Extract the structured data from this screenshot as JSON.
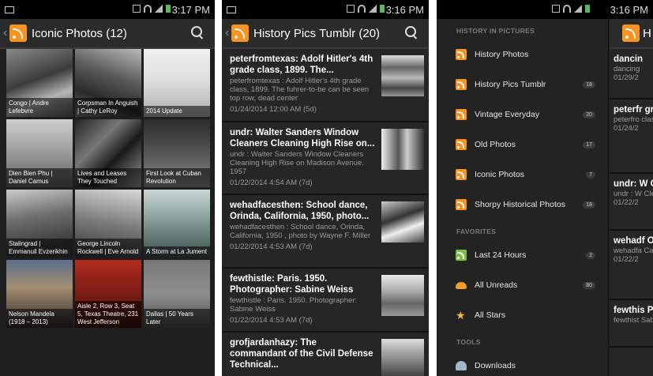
{
  "p1": {
    "time": "3:17 PM",
    "title": "Iconic Photos (12)",
    "tiles": [
      "Congo | Andre Lefebvre",
      "Corpsman In Anguish | Cathy LeRoy",
      "2014 Update",
      "Dien Bien Phu | Daniel Camus",
      "Lives and Leases They Touched",
      "First Look at Cuban Revolution",
      "Stalingrad | Emmanuil Evzerikhin",
      "George Lincoln Rockwell | Eve Arnold",
      "A Storm at La Jument",
      "Nelson Mandela (1918 – 2013)",
      "Aisle 2, Row 3, Seat 5, Texas Theatre, 231 West Jefferson",
      "Dallas | 50 Years Later"
    ]
  },
  "p2": {
    "time": "3:16 PM",
    "title": "History Pics Tumblr (20)",
    "entries": [
      {
        "title": "peterfromtexas: Adolf Hitler's 4th grade class, 1899. The...",
        "snippet": "peterfromtexas : Adolf Hitler's 4th grade class, 1899. The fuhrer-to-be can be seen top row, dead center",
        "date": "01/24/2014 12:00 AM (5d)"
      },
      {
        "title": "undr: Walter Sanders Window Cleaners Cleaning High Rise on...",
        "snippet": "undr : Walter Sanders Window Cleaners Cleaning High Rise on Madison Avenue. 1957",
        "date": "01/22/2014 4:54 AM (7d)"
      },
      {
        "title": "wehadfacesthen: School dance, Orinda, California, 1950, photo...",
        "snippet": "wehadfacesthen : School dance, Orinda, California, 1950 , photo by Wayne F. Miller",
        "date": "01/22/2014 4:53 AM (7d)"
      },
      {
        "title": "fewthistle: Paris. 1950. Photographer: Sabine Weiss",
        "snippet": "fewthistle : Paris. 1950. Photographer: Sabine Weiss",
        "date": "01/22/2014 4:53 AM (7d)"
      },
      {
        "title": "grofjardanhazy: The commandant of the Civil Defense Technical...",
        "snippet": "",
        "date": ""
      }
    ]
  },
  "p3": {
    "time": "3:16 PM",
    "peek_title": "H",
    "sections": {
      "history": "HISTORY IN PICTURES",
      "favorites": "FAVORITES",
      "tools": "TOOLS"
    },
    "history_items": [
      {
        "label": "History Photos",
        "badge": ""
      },
      {
        "label": "History Pics Tumblr",
        "badge": "18"
      },
      {
        "label": "Vintage Everyday",
        "badge": "20"
      },
      {
        "label": "Old Photos",
        "badge": "17"
      },
      {
        "label": "Iconic Photos",
        "badge": "7"
      },
      {
        "label": "Shorpy Historical Photos",
        "badge": "18"
      }
    ],
    "favorite_items": [
      {
        "label": "Last 24 Hours",
        "badge": "2"
      },
      {
        "label": "All Unreads",
        "badge": "80"
      },
      {
        "label": "All Stars",
        "badge": ""
      }
    ],
    "tool_items": [
      {
        "label": "Downloads",
        "badge": ""
      }
    ],
    "peek_entries": [
      {
        "title": "dancin",
        "snippet": "dancing",
        "date": "01/29/2"
      },
      {
        "title": "peterfr grade c",
        "snippet": "peterfro class, 1 seen top",
        "date": "01/24/2"
      },
      {
        "title": "undr: W Cleane",
        "snippet": "undr : W Cleanin 1957",
        "date": "01/22/2"
      },
      {
        "title": "wehadf Orinda",
        "snippet": "wehadfa Californ Miller",
        "date": "01/22/2"
      },
      {
        "title": "fewthis Photog",
        "snippet": "fewthist Sabine",
        "date": ""
      }
    ]
  }
}
